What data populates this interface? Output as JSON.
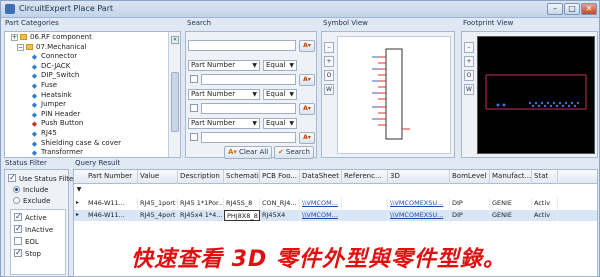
{
  "window": {
    "title": "CircuitExpert Place Part",
    "min": "–",
    "max": "□",
    "close": "✕"
  },
  "part_categories": {
    "header": "Part Categories",
    "items": [
      {
        "label": "06.RF component",
        "kind": "folder"
      },
      {
        "label": "07.Mechanical",
        "kind": "folder"
      },
      {
        "label": "Connector",
        "kind": "part"
      },
      {
        "label": "DC-JACK",
        "kind": "part"
      },
      {
        "label": "DIP_Switch",
        "kind": "part"
      },
      {
        "label": "Fuse",
        "kind": "part"
      },
      {
        "label": "Heatsink",
        "kind": "part"
      },
      {
        "label": "Jumper",
        "kind": "part"
      },
      {
        "label": "PIN Header",
        "kind": "part"
      },
      {
        "label": "Push Button",
        "kind": "partred"
      },
      {
        "label": "RJ45",
        "kind": "part"
      },
      {
        "label": "Shielding case & cover",
        "kind": "part"
      },
      {
        "label": "Transformer",
        "kind": "part"
      }
    ]
  },
  "search": {
    "header": "Search",
    "rows": [
      {
        "field": "Part Number",
        "op": "Equal"
      },
      {
        "field": "Part Number",
        "op": "Equal"
      },
      {
        "field": "Part Number",
        "op": "Equal"
      }
    ],
    "clear_all": "Clear All",
    "search": "Search"
  },
  "symbol_view": {
    "header": "Symbol View",
    "tools": [
      "–",
      "+",
      "O",
      "W"
    ]
  },
  "footprint_view": {
    "header": "Footprint View",
    "tools": [
      "–",
      "+",
      "O",
      "W"
    ]
  },
  "status_filter": {
    "header": "Status Filter",
    "use_status_filter": "Use Status Filter",
    "include": "Include",
    "exclude": "Exclude",
    "statuses": [
      {
        "label": "Active",
        "checked": true
      },
      {
        "label": "InActive",
        "checked": true
      },
      {
        "label": "EOL",
        "checked": false
      },
      {
        "label": "Stop",
        "checked": true
      }
    ]
  },
  "query_result": {
    "header": "Query Result",
    "columns": [
      "Part Number",
      "Value",
      "Description",
      "Schemati...",
      "PCB Foo...",
      "DataSheet",
      "Referenc...",
      "3D",
      "BomLevel",
      "Manufact...",
      "Stat"
    ],
    "rows": [
      [
        "M46-W11...",
        "RJ45_1port",
        "RJ45 1*1Por...",
        "RJ45S_8",
        "CON_RJ4...",
        "\\\\VMCOM...",
        "",
        "\\\\VMCOMEXSU...",
        "DIP",
        "GENIE",
        "Activ"
      ],
      [
        "M46-W11...",
        "RJ45_4port",
        "RJ45x4 1*4...",
        "PHJ8X8_8",
        "RJ45X4",
        "\\\\VMCOM...",
        "",
        "\\\\VMCOMEXSU...",
        "DIP",
        "GENIE",
        "Activ"
      ]
    ]
  },
  "banner_text": "快速查看 3D 零件外型與零件型錄。",
  "colors": {
    "banner": "#e01010",
    "link": "#1a4ea8",
    "footprint_bg": "#000000",
    "footprint_outline": "#c0306a"
  }
}
